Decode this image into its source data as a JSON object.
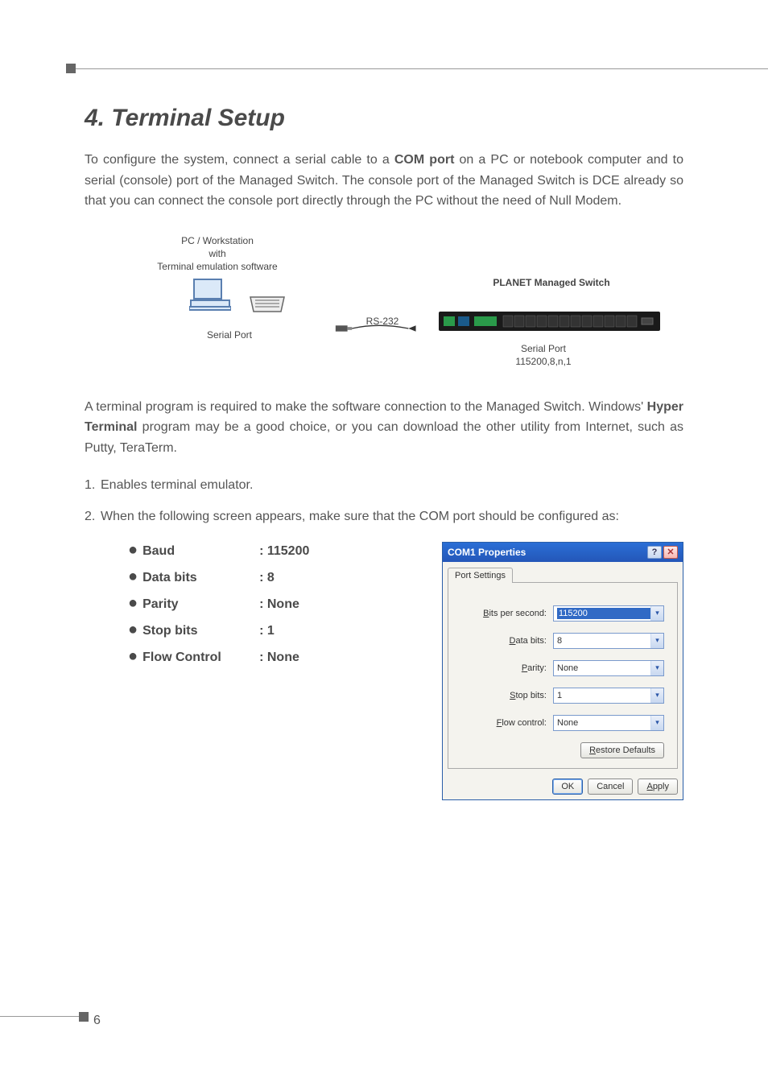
{
  "header": {
    "title": "4. Terminal Setup"
  },
  "paragraphs": {
    "p1_a": "To configure the system, connect a serial cable to a ",
    "p1_b": "COM port",
    "p1_c": " on a PC or notebook computer and to serial (console) port of the Managed Switch. The console port of the Managed Switch is DCE already so that you can connect the console port directly through the PC without the need of Null Modem.",
    "p2_a": "A terminal program is required to make the software connection to the Managed Switch. Windows' ",
    "p2_b": "Hyper Terminal",
    "p2_c": " program may be a good choice, or you can download the other utility from Internet, such as Putty, TeraTerm."
  },
  "diagram": {
    "pc_label": "PC / Workstation\nwith\nTerminal emulation software",
    "serial_port_left": "Serial Port",
    "rs232": "RS-232",
    "switch_label": "PLANET Managed Switch",
    "serial_port_right": "Serial Port\n115200,8,n,1"
  },
  "list": {
    "item1": "Enables terminal emulator.",
    "item2": "When the following screen appears, make sure that the COM port should be configured as:"
  },
  "settings": [
    {
      "key": "Baud",
      "val": ": 115200"
    },
    {
      "key": "Data bits",
      "val": ": 8"
    },
    {
      "key": "Parity",
      "val": ": None"
    },
    {
      "key": "Stop bits",
      "val": ": 1"
    },
    {
      "key": "Flow Control",
      "val": ": None"
    }
  ],
  "dialog": {
    "title": "COM1 Properties",
    "tab": "Port Settings",
    "fields": {
      "bits_per_second": {
        "label": "Bits per second:",
        "value": "115200",
        "underline": "B"
      },
      "data_bits": {
        "label": "Data bits:",
        "value": "8",
        "underline": "D"
      },
      "parity": {
        "label": "Parity:",
        "value": "None",
        "underline": "P"
      },
      "stop_bits": {
        "label": "Stop bits:",
        "value": "1",
        "underline": "S"
      },
      "flow_control": {
        "label": "Flow control:",
        "value": "None",
        "underline": "F"
      }
    },
    "restore": "Restore Defaults",
    "ok": "OK",
    "cancel": "Cancel",
    "apply": "Apply"
  },
  "page_number": "6"
}
